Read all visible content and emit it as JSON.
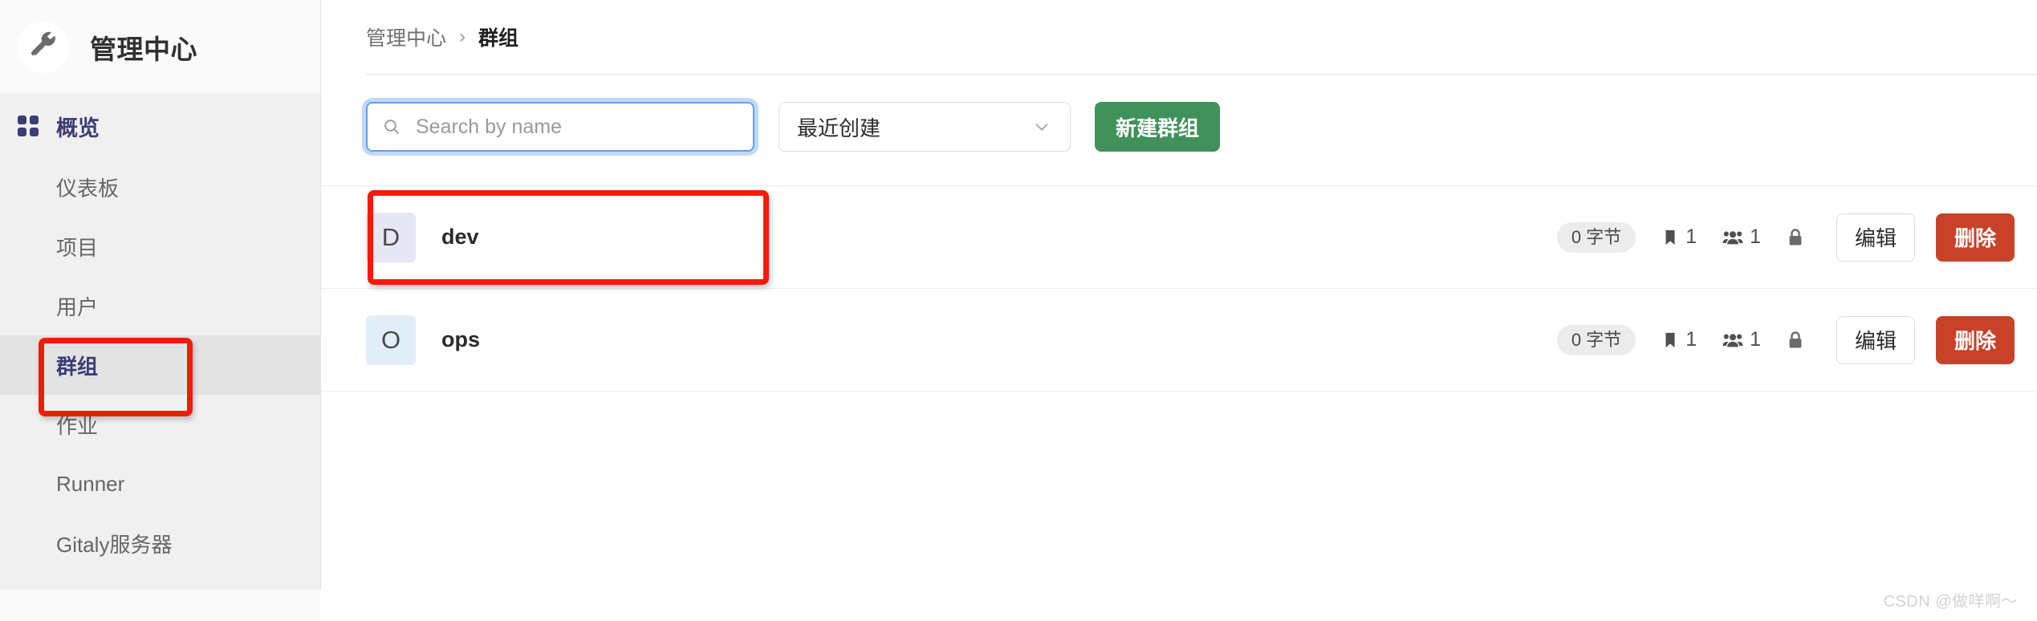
{
  "sidebar": {
    "brand": {
      "title": "管理中心",
      "logo_icon": "wrench-icon"
    },
    "overview": {
      "label": "概览",
      "icon": "grid-icon"
    },
    "items": [
      {
        "label": "仪表板",
        "active": false
      },
      {
        "label": "项目",
        "active": false
      },
      {
        "label": "用户",
        "active": false
      },
      {
        "label": "群组",
        "active": true
      },
      {
        "label": "作业",
        "active": false
      },
      {
        "label": "Runner",
        "active": false
      },
      {
        "label": "Gitaly服务器",
        "active": false
      }
    ]
  },
  "breadcrumb": {
    "root": "管理中心",
    "separator": "›",
    "current": "群组"
  },
  "toolbar": {
    "search": {
      "placeholder": "Search by name",
      "value": "",
      "icon": "search-icon"
    },
    "sort": {
      "selected": "最近创建",
      "icon": "chevron-down-icon"
    },
    "new_group_label": "新建群组"
  },
  "groups": [
    {
      "initial": "D",
      "avatar_color": "#e6e6f4",
      "name": "dev",
      "size": "0 字节",
      "projects_icon": "bookmark-icon",
      "projects": "1",
      "members_icon": "users-icon",
      "members": "1",
      "visibility_icon": "lock-icon",
      "edit_label": "编辑",
      "delete_label": "删除"
    },
    {
      "initial": "O",
      "avatar_color": "#e1eef8",
      "name": "ops",
      "size": "0 字节",
      "projects_icon": "bookmark-icon",
      "projects": "1",
      "members_icon": "users-icon",
      "members": "1",
      "visibility_icon": "lock-icon",
      "edit_label": "编辑",
      "delete_label": "删除"
    }
  ],
  "annotations": {
    "sidebar_highlight": "群组",
    "row_highlight": "dev"
  },
  "watermark": "CSDN @做咩啊～",
  "colors": {
    "accent_nav": "#3c3c76",
    "primary_button": "#40925a",
    "danger_button": "#c74228",
    "focus_ring": "#63a0f0",
    "annotation": "#f01c08"
  }
}
